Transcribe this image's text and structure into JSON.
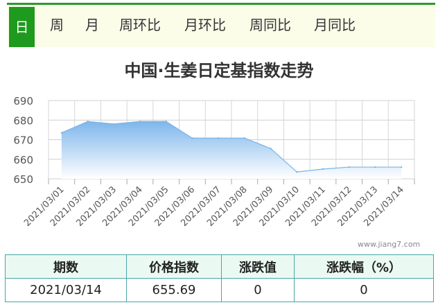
{
  "tabs": [
    {
      "label": "日",
      "active": true
    },
    {
      "label": "周"
    },
    {
      "label": "月"
    },
    {
      "label": "周环比"
    },
    {
      "label": "月环比"
    },
    {
      "label": "周同比"
    },
    {
      "label": "月同比"
    }
  ],
  "watermark": "www.jiang7.com",
  "table": {
    "headers": [
      "期数",
      "价格指数",
      "涨跌值",
      "涨跌幅（%）"
    ],
    "row": [
      "2021/03/14",
      "655.69",
      "0",
      "0"
    ]
  },
  "colors": {
    "accent": "#1e9a1e",
    "line": "#7ab4e6",
    "fill_top": "#7eb6ec",
    "fill_bottom": "#ffffff"
  },
  "chart_data": {
    "type": "area",
    "title": "中国·生姜日定基指数走势",
    "x": [
      "2021/03/01",
      "2021/03/02",
      "2021/03/03",
      "2021/03/04",
      "2021/03/05",
      "2021/03/06",
      "2021/03/07",
      "2021/03/08",
      "2021/03/09",
      "2021/03/10",
      "2021/03/11",
      "2021/03/12",
      "2021/03/13",
      "2021/03/14"
    ],
    "values": [
      673.5,
      679.3,
      678.0,
      679.3,
      679.3,
      670.8,
      670.8,
      670.8,
      665.5,
      653.5,
      655.0,
      656.0,
      656.0,
      656.0
    ],
    "yticks": [
      650,
      660,
      670,
      680,
      690
    ],
    "ylim": [
      650,
      690
    ],
    "xlabel": "",
    "ylabel": "",
    "grid": true
  }
}
